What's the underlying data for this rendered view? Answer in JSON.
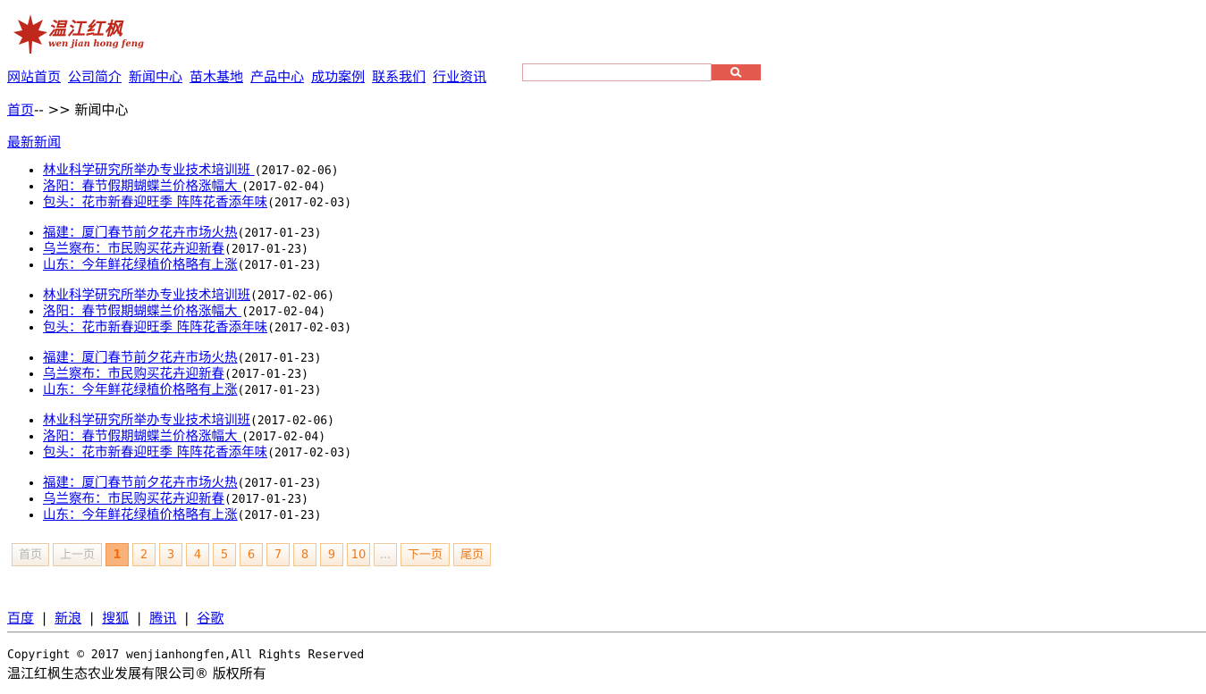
{
  "logo": {
    "cn": "温江红枫",
    "en": "wen jian hong feng"
  },
  "nav": [
    "网站首页",
    "公司简介",
    "新闻中心",
    "苗木基地",
    "产品中心",
    "成功案例",
    "联系我们",
    "行业资讯 "
  ],
  "search": {
    "placeholder": ""
  },
  "breadcrumb": {
    "home": "首页",
    "sep": "-- >> ",
    "current": "新闻中心"
  },
  "section_title": "最新新闻",
  "news_groups": [
    [
      {
        "title": "林业科学研究所举办专业技术培训班 ",
        "date": "(2017-02-06)"
      },
      {
        "title": "洛阳：春节假期蝴蝶兰价格涨幅大 ",
        "date": "(2017-02-04)"
      },
      {
        "title": "包头：花市新春迎旺季 阵阵花香添年味",
        "date": "(2017-02-03)"
      }
    ],
    [
      {
        "title": "福建：厦门春节前夕花卉市场火热",
        "date": "(2017-01-23)"
      },
      {
        "title": "乌兰察布：市民购买花卉迎新春",
        "date": "(2017-01-23)"
      },
      {
        "title": "山东：今年鲜花绿植价格略有上涨",
        "date": "(2017-01-23)"
      }
    ],
    [
      {
        "title": "林业科学研究所举办专业技术培训班",
        "date": "(2017-02-06)"
      },
      {
        "title": "洛阳：春节假期蝴蝶兰价格涨幅大 ",
        "date": "(2017-02-04)"
      },
      {
        "title": "包头：花市新春迎旺季 阵阵花香添年味",
        "date": "(2017-02-03)"
      }
    ],
    [
      {
        "title": "福建：厦门春节前夕花卉市场火热",
        "date": "(2017-01-23)"
      },
      {
        "title": "乌兰察布：市民购买花卉迎新春",
        "date": "(2017-01-23)"
      },
      {
        "title": "山东：今年鲜花绿植价格略有上涨",
        "date": "(2017-01-23)"
      }
    ],
    [
      {
        "title": "林业科学研究所举办专业技术培训班",
        "date": "(2017-02-06)"
      },
      {
        "title": "洛阳：春节假期蝴蝶兰价格涨幅大 ",
        "date": "(2017-02-04)"
      },
      {
        "title": "包头：花市新春迎旺季 阵阵花香添年味",
        "date": "(2017-02-03)"
      }
    ],
    [
      {
        "title": "福建：厦门春节前夕花卉市场火热",
        "date": "(2017-01-23)"
      },
      {
        "title": "乌兰察布：市民购买花卉迎新春",
        "date": "(2017-01-23)"
      },
      {
        "title": "山东：今年鲜花绿植价格略有上涨",
        "date": "(2017-01-23)"
      }
    ]
  ],
  "pager": {
    "first": "首页",
    "prev": "上一页",
    "pages": [
      "1",
      "2",
      "3",
      "4",
      "5",
      "6",
      "7",
      "8",
      "9",
      "10"
    ],
    "current": "1",
    "ellipsis": "...",
    "next": "下一页",
    "last": "尾页"
  },
  "footer_links": [
    "百度",
    "新浪",
    "搜狐",
    "腾讯",
    "谷歌"
  ],
  "footer_sep": "|",
  "copyright": "Copyright © 2017 wenjianhongfen,All Rights Reserved",
  "company": "温江红枫生态农业发展有限公司® 版权所有",
  "colors": {
    "brand_red": "#c0281c",
    "link": "#0000ee",
    "pager_orange": "#ee7a1a",
    "search_btn": "#e55a4f"
  }
}
